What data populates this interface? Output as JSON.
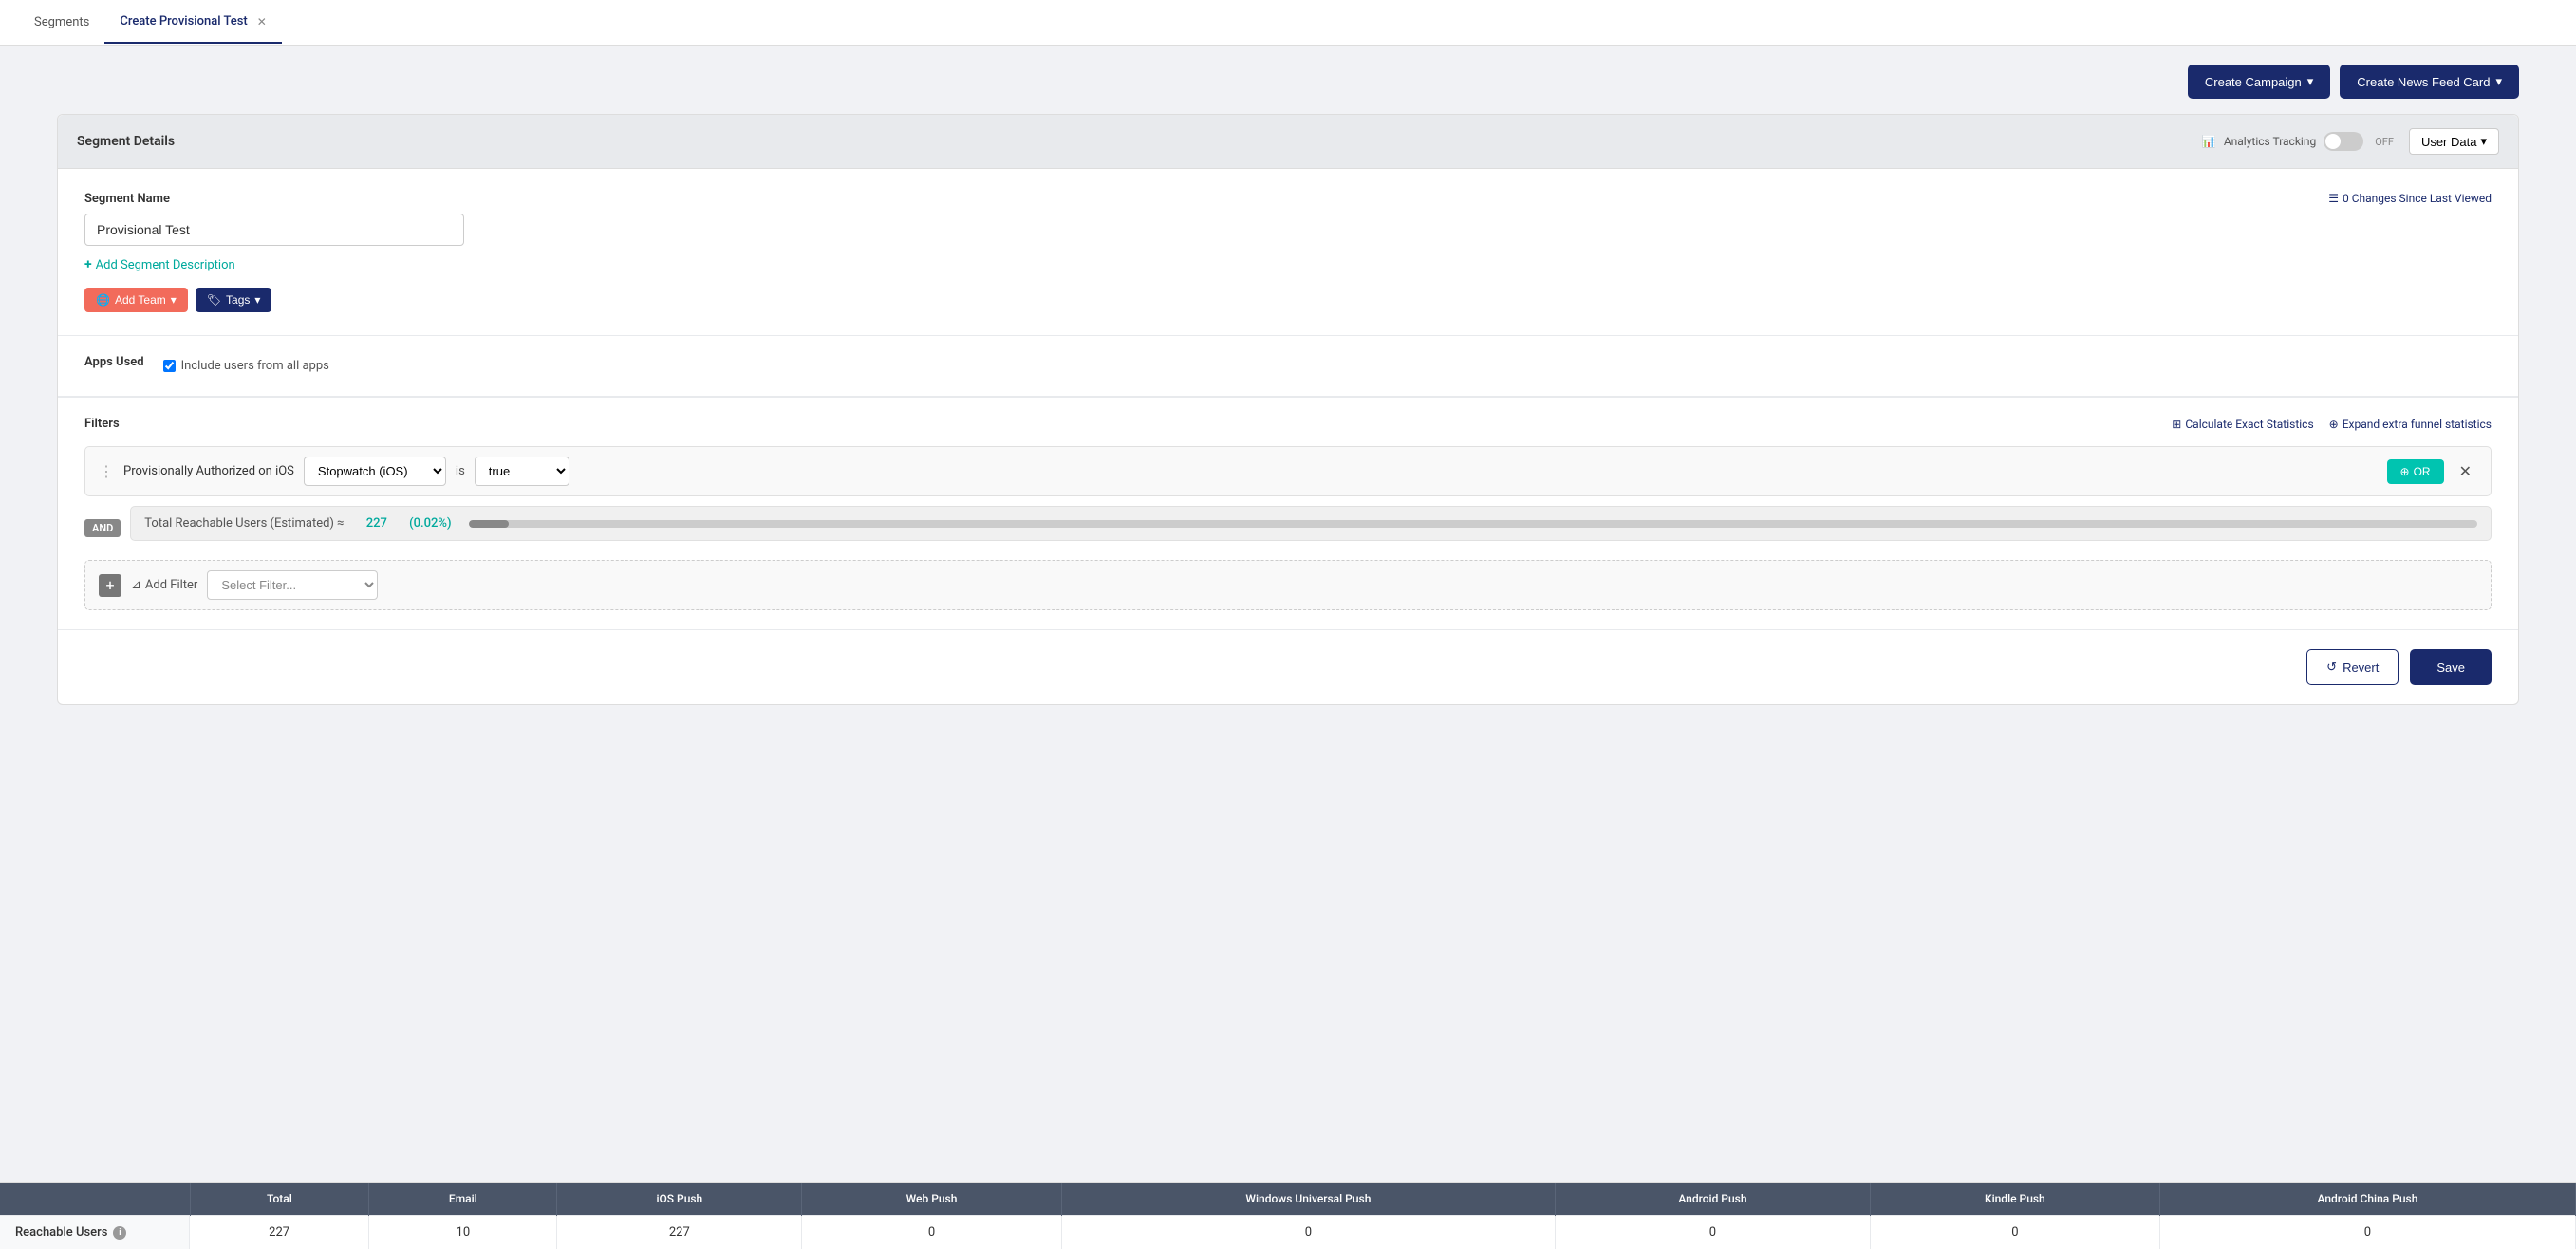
{
  "tabs": [
    {
      "id": "segments",
      "label": "Segments",
      "active": false,
      "closeable": false
    },
    {
      "id": "create-provisional-test",
      "label": "Create Provisional Test",
      "active": true,
      "closeable": true
    }
  ],
  "action_buttons": {
    "create_campaign": "Create Campaign",
    "create_news_feed": "Create News Feed Card"
  },
  "segment_details": {
    "header_title": "Segment Details",
    "analytics_tracking_label": "Analytics Tracking",
    "toggle_state": "OFF",
    "user_data_label": "User Data",
    "segment_name_label": "Segment Name",
    "segment_name_value": "Provisional Test",
    "changes_label": "0 Changes Since Last Viewed",
    "add_description_label": "Add Segment Description",
    "add_team_label": "Add Team",
    "tags_label": "Tags"
  },
  "apps_used": {
    "label": "Apps Used",
    "checkbox_label": "Include users from all apps",
    "checked": true
  },
  "filters": {
    "label": "Filters",
    "calculate_link": "Calculate Exact Statistics",
    "expand_link": "Expand extra funnel statistics",
    "filter_row": {
      "condition": "Provisionally Authorized on iOS",
      "app_value": "Stopwatch (iOS)",
      "operator": "is",
      "value": "true"
    },
    "and_label": "AND",
    "reachable_text": "Total Reachable Users (Estimated) ≈",
    "reachable_count": "227",
    "reachable_pct": "(0.02%)",
    "add_filter_label": "Add Filter",
    "select_filter_placeholder": "Select Filter...",
    "or_label": "OR"
  },
  "footer": {
    "revert_label": "Revert",
    "save_label": "Save"
  },
  "stats_table": {
    "columns": [
      "",
      "Total",
      "Email",
      "iOS Push",
      "Web Push",
      "Windows Universal Push",
      "Android Push",
      "Kindle Push",
      "Android China Push"
    ],
    "rows": [
      {
        "label": "Reachable Users",
        "total": "227",
        "email": "10",
        "ios_push": "227",
        "web_push": "0",
        "windows_universal_push": "0",
        "android_push": "0",
        "kindle_push": "0",
        "android_china_push": "0"
      }
    ]
  }
}
